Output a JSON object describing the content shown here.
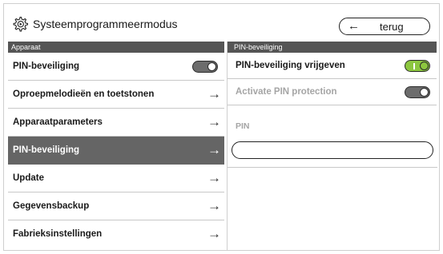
{
  "header": {
    "title": "Systeemprogrammeermodus",
    "back_label": "terug",
    "back_arrow": "←"
  },
  "left": {
    "section_title": "Apparaat",
    "items": [
      {
        "label": "PIN-beveiliging",
        "control": "toggle",
        "state": "off"
      },
      {
        "label": "Oproepmelodieën en toetstonen",
        "control": "arrow"
      },
      {
        "label": "Apparaatparameters",
        "control": "arrow"
      },
      {
        "label": "PIN-beveiliging",
        "control": "arrow",
        "active": true
      },
      {
        "label": "Update",
        "control": "arrow"
      },
      {
        "label": "Gegevensbackup",
        "control": "arrow"
      },
      {
        "label": "Fabrieksinstellingen",
        "control": "arrow"
      }
    ],
    "arrow_glyph": "→"
  },
  "right": {
    "section_title": "PIN-beveiliging",
    "enable_label": "PIN-beveiliging vrijgeven",
    "enable_state": "on",
    "activate_label": "Activate PIN protection",
    "activate_state": "off",
    "pin_label": "PIN",
    "pin_value": ""
  },
  "colors": {
    "section_header": "#555555",
    "active_item": "#656565",
    "toggle_on": "#8cc63f",
    "toggle_off": "#6c6c6c",
    "disabled_text": "#a5a5a5"
  }
}
